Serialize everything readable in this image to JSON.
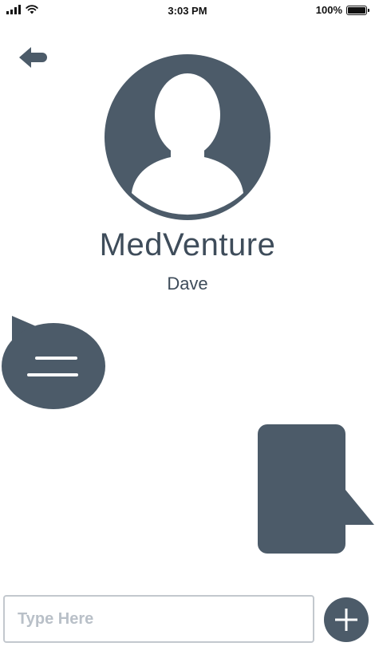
{
  "status_bar": {
    "time": "3:03 PM",
    "battery": "100%",
    "icons": [
      "signal-icon",
      "wifi-icon",
      "battery-icon"
    ]
  },
  "header": {
    "back_icon": "back-arrow-icon",
    "avatar_icon": "user-silhouette-icon",
    "org_name": "MedVenture",
    "contact_name": "Dave"
  },
  "messages": [
    {
      "direction": "incoming",
      "icon": "incoming-speech-bubble"
    },
    {
      "direction": "outgoing",
      "icon": "outgoing-speech-bubble"
    }
  ],
  "composer": {
    "placeholder": "Type Here",
    "value": "",
    "add_icon": "plus-icon"
  },
  "colors": {
    "accent": "#4c5b69",
    "text": "#3e4c5a",
    "input_border": "#c3c8ce",
    "placeholder": "#b9c0c8"
  }
}
